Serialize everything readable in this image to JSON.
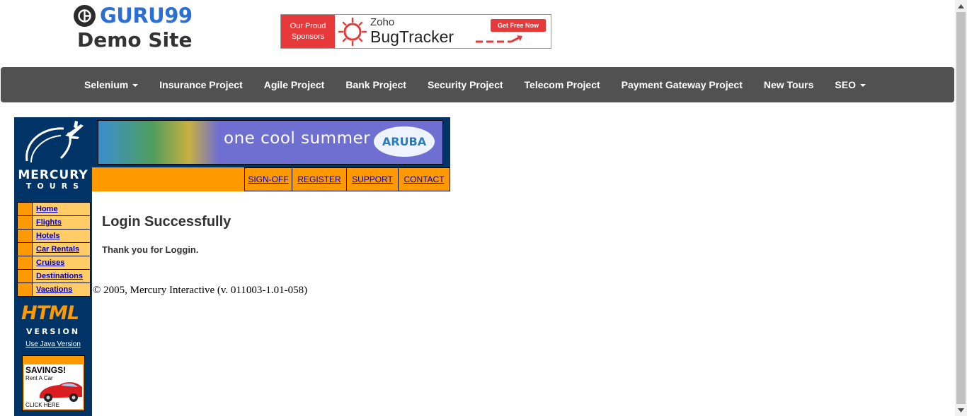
{
  "header": {
    "brand": "GURU99",
    "subtitle": "Demo Site",
    "sponsor": {
      "tag_line1": "Our Proud",
      "tag_line2": "Sponsors",
      "product_vendor": "Zoho",
      "product_name": "BugTracker",
      "cta": "Get Free Now"
    }
  },
  "nav": {
    "items": [
      {
        "label": "Selenium",
        "dropdown": true
      },
      {
        "label": "Insurance Project"
      },
      {
        "label": "Agile Project"
      },
      {
        "label": "Bank Project"
      },
      {
        "label": "Security Project"
      },
      {
        "label": "Telecom Project"
      },
      {
        "label": "Payment Gateway Project"
      },
      {
        "label": "New Tours"
      },
      {
        "label": "SEO",
        "dropdown": true
      }
    ]
  },
  "mercury": {
    "title_line1": "MERCURY",
    "title_line2": "TOURS",
    "banner_text": "one cool summer",
    "banner_logo": "ARUBA",
    "top_links": [
      "SIGN-OFF",
      "REGISTER",
      "SUPPORT",
      "CONTACT"
    ],
    "menu": [
      "Home",
      "Flights",
      "Hotels",
      "Car Rentals",
      "Cruises",
      "Destinations",
      "Vacations"
    ],
    "html_version_big": "HTML",
    "html_version_small": "VERSION",
    "java_link": "Use Java Version",
    "savings": {
      "title": "SAVINGS!",
      "subtitle": "Rent A Car",
      "cta": "CLICK HERE"
    }
  },
  "content": {
    "title": "Login Successfully",
    "message": "Thank you for Loggin."
  },
  "footer": {
    "copyright": "© 2005, Mercury Interactive (v. 011003-1.01-058)"
  },
  "colors": {
    "nav_bg": "#515151",
    "brand_blue": "#2a6fd6",
    "mercury_navy": "#003366",
    "mercury_orange": "#ff9900",
    "menu_cell": "#ffcc66",
    "link_blue": "#0000cc"
  }
}
